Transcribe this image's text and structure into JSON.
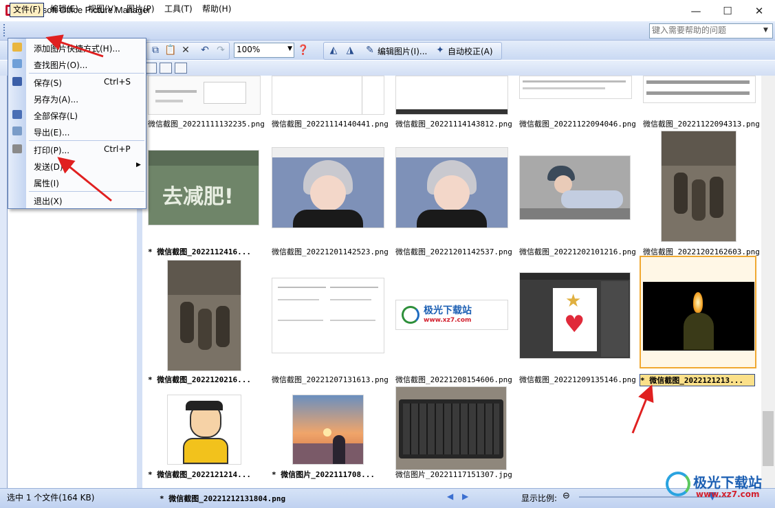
{
  "window": {
    "title": "Microsoft Office Picture Manager",
    "minimize": "—",
    "maximize": "☐",
    "close": "✕"
  },
  "menubar": {
    "items": [
      "文件(F)",
      "编辑(E)",
      "视图(V)",
      "图片(P)",
      "工具(T)",
      "帮助(H)"
    ],
    "help_placeholder": "键入需要帮助的问题"
  },
  "toolbar": {
    "zoom": "100%",
    "edit_label": "编辑图片(I)...",
    "autofix_label": "自动校正(A)"
  },
  "file_menu": {
    "items": [
      {
        "label": "添加图片快捷方式(H)...",
        "shortcut": ""
      },
      {
        "label": "查找图片(O)...",
        "shortcut": ""
      },
      {
        "label": "保存(S)",
        "shortcut": "Ctrl+S"
      },
      {
        "label": "另存为(A)...",
        "shortcut": ""
      },
      {
        "label": "全部保存(L)",
        "shortcut": ""
      },
      {
        "label": "导出(E)...",
        "shortcut": ""
      },
      {
        "label": "打印(P)...",
        "shortcut": "Ctrl+P"
      },
      {
        "label": "发送(D)",
        "shortcut": ""
      },
      {
        "label": "属性(I)",
        "shortcut": ""
      },
      {
        "label": "退出(X)",
        "shortcut": ""
      }
    ]
  },
  "thumbnails": [
    {
      "caption": "微信截图_20221111132235.png",
      "modified": false
    },
    {
      "caption": "微信截图_20221114140441.png",
      "modified": false
    },
    {
      "caption": "微信截图_20221114143812.png",
      "modified": false
    },
    {
      "caption": "微信截图_20221122094046.png",
      "modified": false
    },
    {
      "caption": "微信截图_20221122094313.png",
      "modified": false
    },
    {
      "caption": "* 微信截图_2022112416...",
      "modified": true,
      "image_text": "去减肥!"
    },
    {
      "caption": "微信截图_20221201142523.png",
      "modified": false
    },
    {
      "caption": "微信截图_20221201142537.png",
      "modified": false
    },
    {
      "caption": "微信截图_20221202101216.png",
      "modified": false
    },
    {
      "caption": "微信截图_20221202162603.png",
      "modified": false
    },
    {
      "caption": "* 微信截图_2022120216...",
      "modified": true
    },
    {
      "caption": "微信截图_20221207131613.png",
      "modified": false
    },
    {
      "caption": "微信截图_20221208154606.png",
      "modified": false,
      "image_text": "极光下载站",
      "image_subtext": "www.xz7.com"
    },
    {
      "caption": "微信截图_20221209135146.png",
      "modified": false
    },
    {
      "caption": "* 微信截图_2022121213...",
      "modified": true,
      "selected": true
    },
    {
      "caption": "* 微信截图_2022121214...",
      "modified": true
    },
    {
      "caption": "* 微信图片_2022111708...",
      "modified": true
    },
    {
      "caption": "微信图片_20221117151307.jpg",
      "modified": false
    }
  ],
  "statusbar": {
    "selection": "选中 1 个文件(164 KB)",
    "current_file": "* 微信截图_20221212131804.png",
    "zoom_label": "显示比例:"
  },
  "watermark": {
    "text": "极光下载站",
    "url": "www.xz7.com"
  },
  "colors": {
    "menu_highlight": "#ffeec2",
    "selection_border": "#f0a830",
    "annotation_red": "#e02020"
  }
}
